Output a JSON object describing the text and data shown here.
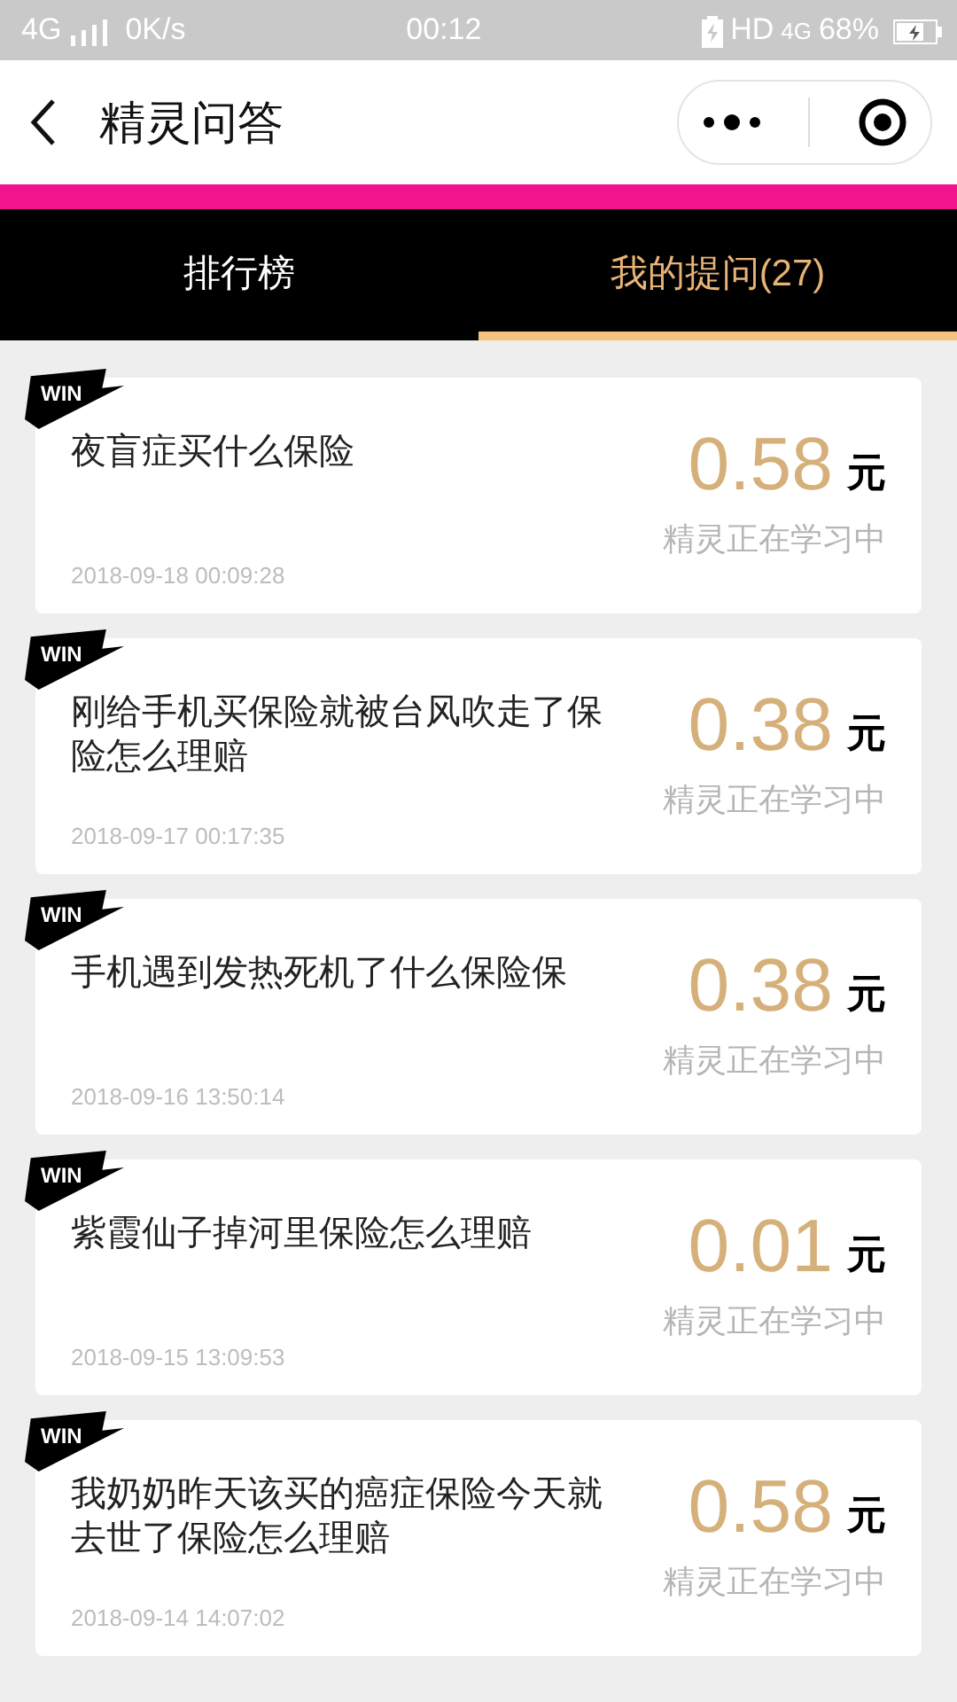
{
  "status_bar": {
    "network": "4G",
    "speed": "0K/s",
    "time": "00:12",
    "hd": "HD",
    "data": "4G",
    "battery": "68%"
  },
  "header": {
    "title": "精灵问答"
  },
  "tabs": [
    {
      "label": "排行榜",
      "selected": false
    },
    {
      "label": "我的提问(27)",
      "selected": true
    }
  ],
  "questions": [
    {
      "badge": "WIN",
      "question": "夜盲症买什么保险",
      "amount": "0.58",
      "unit": "元",
      "status": "精灵正在学习中",
      "date": "2018-09-18 00:09:28"
    },
    {
      "badge": "WIN",
      "question": "刚给手机买保险就被台风吹走了保险怎么理赔",
      "amount": "0.38",
      "unit": "元",
      "status": "精灵正在学习中",
      "date": "2018-09-17 00:17:35"
    },
    {
      "badge": "WIN",
      "question": "手机遇到发热死机了什么保险保",
      "amount": "0.38",
      "unit": "元",
      "status": "精灵正在学习中",
      "date": "2018-09-16 13:50:14"
    },
    {
      "badge": "WIN",
      "question": "紫霞仙子掉河里保险怎么理赔",
      "amount": "0.01",
      "unit": "元",
      "status": "精灵正在学习中",
      "date": "2018-09-15 13:09:53"
    },
    {
      "badge": "WIN",
      "question": "我奶奶昨天该买的癌症保险今天就去世了保险怎么理赔",
      "amount": "0.58",
      "unit": "元",
      "status": "精灵正在学习中",
      "date": "2018-09-14 14:07:02"
    }
  ]
}
